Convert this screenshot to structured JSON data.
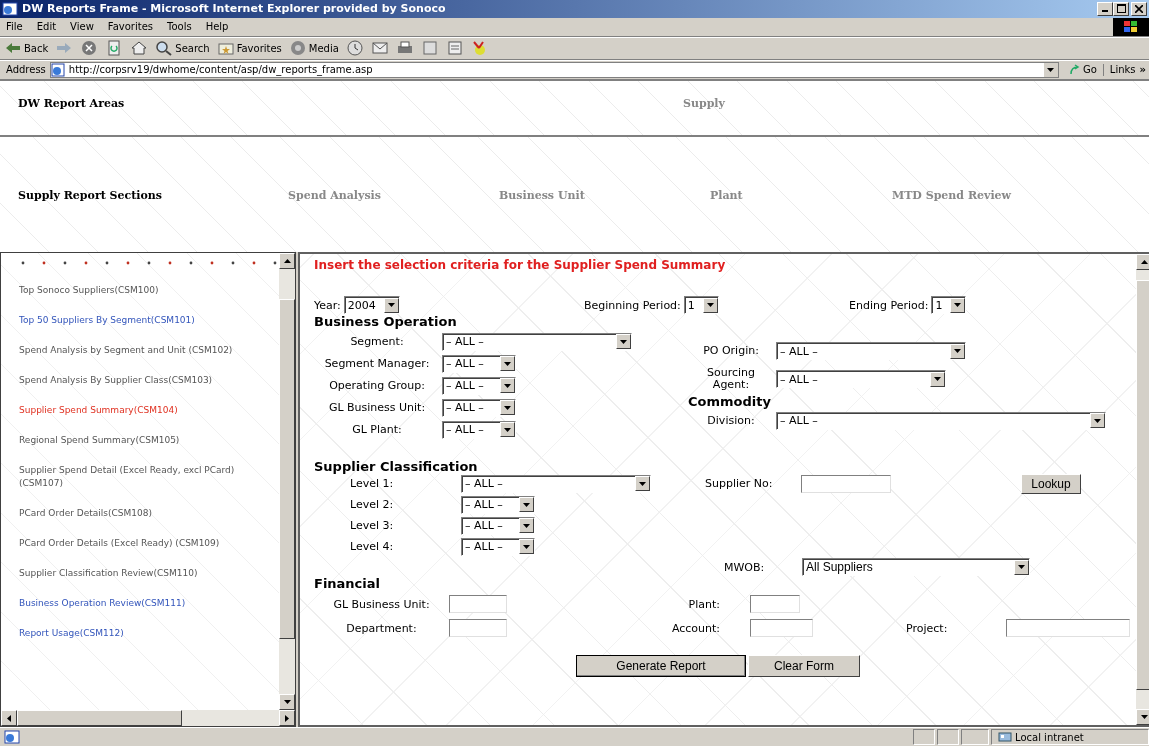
{
  "window": {
    "title": "DW Reports Frame - Microsoft Internet Explorer provided by Sonoco"
  },
  "menu": [
    "File",
    "Edit",
    "View",
    "Favorites",
    "Tools",
    "Help"
  ],
  "toolbar": [
    {
      "kind": "back",
      "label": "Back"
    },
    {
      "kind": "forward"
    },
    {
      "kind": "stop"
    },
    {
      "kind": "refresh"
    },
    {
      "kind": "home"
    },
    {
      "kind": "search",
      "label": "Search"
    },
    {
      "kind": "favorites",
      "label": "Favorites"
    },
    {
      "kind": "media",
      "label": "Media"
    },
    {
      "kind": "history"
    },
    {
      "kind": "mail"
    },
    {
      "kind": "print"
    },
    {
      "kind": "edit"
    },
    {
      "kind": "discuss"
    },
    {
      "kind": "messenger"
    }
  ],
  "address": {
    "label": "Address",
    "value": "http://corpsrv19/dwhome/content/asp/dw_reports_frame.asp",
    "go": "Go",
    "links": "Links",
    "links_more": "»"
  },
  "report_areas": {
    "title": "DW Report Areas",
    "items": [
      "Supply"
    ]
  },
  "report_sections": {
    "title": "Supply Report Sections",
    "items": [
      "Spend Analysis",
      "Business Unit",
      "Plant",
      "MTD Spend Review"
    ]
  },
  "sidebar": {
    "items": [
      {
        "label": "Top Sonoco Suppliers(CSM100)",
        "visited": true,
        "selected": false
      },
      {
        "label": "Top 50 Suppliers By Segment(CSM101)",
        "visited": false,
        "selected": false
      },
      {
        "label": "Spend Analysis by Segment and Unit (CSM102)",
        "visited": true,
        "selected": false
      },
      {
        "label": "Spend Analysis By Supplier Class(CSM103)",
        "visited": true,
        "selected": false
      },
      {
        "label": "Supplier Spend Summary(CSM104)",
        "visited": true,
        "selected": true
      },
      {
        "label": "Regional Spend Summary(CSM105)",
        "visited": true,
        "selected": false
      },
      {
        "label": "Supplier Spend Detail (Excel Ready, excl PCard)(CSM107)",
        "visited": true,
        "selected": false
      },
      {
        "label": "PCard Order Details(CSM108)",
        "visited": true,
        "selected": false
      },
      {
        "label": "PCard Order Details (Excel Ready) (CSM109)",
        "visited": true,
        "selected": false
      },
      {
        "label": "Supplier Classification Review(CSM110)",
        "visited": true,
        "selected": false
      },
      {
        "label": "Business Operation Review(CSM111)",
        "visited": false,
        "selected": false
      },
      {
        "label": "Report Usage(CSM112)",
        "visited": false,
        "selected": false
      }
    ]
  },
  "form": {
    "heading": "Insert the selection criteria for the Supplier Spend Summary",
    "period": [
      {
        "label": "Year:",
        "value": "2004"
      },
      {
        "label": "Beginning Period:",
        "value": "1"
      },
      {
        "label": "Ending Period:",
        "value": "1"
      }
    ],
    "business_operation": {
      "title": "Business Operation",
      "fields": [
        {
          "label": "Segment:",
          "value": "– ALL –",
          "kind": "wide"
        },
        {
          "label": "Segment Manager:",
          "value": "– ALL –",
          "kind": "narrow"
        },
        {
          "label": "Operating Group:",
          "value": "– ALL –",
          "kind": "narrow"
        },
        {
          "label": "GL Business Unit:",
          "value": "– ALL –",
          "kind": "narrow"
        },
        {
          "label": "GL Plant:",
          "value": "– ALL –",
          "kind": "narrow"
        }
      ]
    },
    "origin": [
      {
        "label": "PO Origin:",
        "value": "– ALL –",
        "kind": "wide"
      },
      {
        "label": "Sourcing Agent:",
        "value": "– ALL –",
        "kind": "medium"
      }
    ],
    "commodity": {
      "title": "Commodity",
      "fields": [
        {
          "label": "Division:",
          "value": "– ALL –",
          "kind": "full"
        }
      ]
    },
    "supplier_classification": {
      "title": "Supplier Classification",
      "levels": [
        {
          "label": "Level 1:",
          "value": "– ALL –",
          "kind": "wide"
        },
        {
          "label": "Level 2:",
          "value": "– ALL –",
          "kind": "narrow"
        },
        {
          "label": "Level 3:",
          "value": "– ALL –",
          "kind": "narrow"
        },
        {
          "label": "Level 4:",
          "value": "– ALL –",
          "kind": "narrow"
        }
      ],
      "supplier_no": {
        "label": "Supplier No:"
      },
      "lookup": "Lookup",
      "mwob": {
        "label": "MWOB:",
        "value": "All Suppliers"
      }
    },
    "financial": {
      "title": "Financial",
      "fields": [
        {
          "label": "GL Business Unit:"
        },
        {
          "label": "Plant:"
        },
        {
          "label": "Department:"
        },
        {
          "label": "Account:"
        },
        {
          "label": "Project:"
        }
      ]
    },
    "buttons": [
      "Generate Report",
      "Clear Form"
    ]
  },
  "status_bar": {
    "zone": "Local intranet"
  }
}
